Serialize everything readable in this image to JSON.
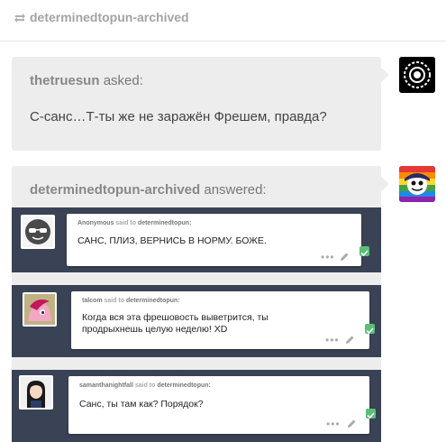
{
  "header": {
    "username": "determinedtopun-archived"
  },
  "ask": {
    "asker": "thetruesun",
    "verb": "asked:",
    "question": "С-санс…Т-ты же не заражён Фрешем, правда?"
  },
  "answer": {
    "answerer": "determinedtopun-archived",
    "verb": "answered:"
  },
  "messages": [
    {
      "sender": "Anonymous",
      "said_to": "said to",
      "recipient": "determinedtopun:",
      "text": "САНС, ПЛИЗ, ВЕРНИСЬ В НОРМУ. БОЖЕ."
    },
    {
      "sender": "talcom",
      "said_to": "said to",
      "recipient": "determinedtopun:",
      "text": "Когда вся эта фрешовость выветрится, ты продрыхнешь целую неделю! XD"
    },
    {
      "sender": "samanthanightfall",
      "said_to": "said to",
      "recipient": "determinedtopun:",
      "text": "Санс, ты там как? Порядок?"
    }
  ],
  "icons": {
    "reblog": "reblog-icon",
    "more": "more-dots-icon",
    "edit": "pencil-icon",
    "check": "checkmark-icon"
  },
  "colors": {
    "panel_bg": "#3a4355",
    "check_green": "#5bbf76",
    "bubble_bg": "#ededed"
  },
  "more_glyph": "•••"
}
